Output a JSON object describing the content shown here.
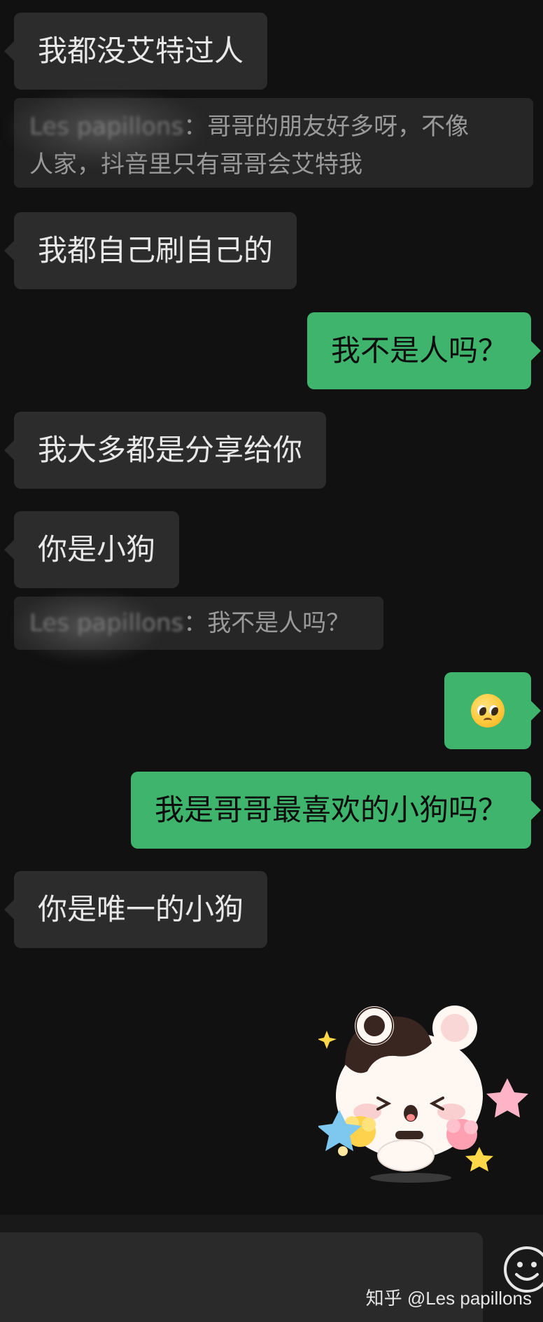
{
  "messages": [
    {
      "side": "left",
      "text": "我都没艾特过人"
    },
    {
      "type": "quote",
      "sender": "Les papillons",
      "text": "哥哥的朋友好多呀，不像人家，抖音里只有哥哥会艾特我",
      "line1": "哥哥的朋友好多呀，不像",
      "line2": "人家，抖音里只有哥哥会艾特我"
    },
    {
      "side": "left",
      "text": "我都自己刷自己的"
    },
    {
      "side": "right",
      "text": "我不是人吗？"
    },
    {
      "side": "left",
      "text": "我大多都是分享给你"
    },
    {
      "side": "left",
      "text": "你是小狗"
    },
    {
      "type": "quote",
      "sender": "Les papillons",
      "text": "我不是人吗？"
    },
    {
      "side": "right",
      "emoji": "pleading-face"
    },
    {
      "side": "right",
      "text": "我是哥哥最喜欢的小狗吗？"
    },
    {
      "side": "left",
      "text": "你是唯一的小狗"
    },
    {
      "side": "right",
      "sticker": "cow-bear-cheering"
    }
  ],
  "quote_separator": "：",
  "watermark": "知乎 @Les papillons",
  "colors": {
    "background": "#111111",
    "incoming_bubble": "#2c2c2c",
    "outgoing_bubble": "#3fb46d",
    "quote_bg": "#262626"
  }
}
